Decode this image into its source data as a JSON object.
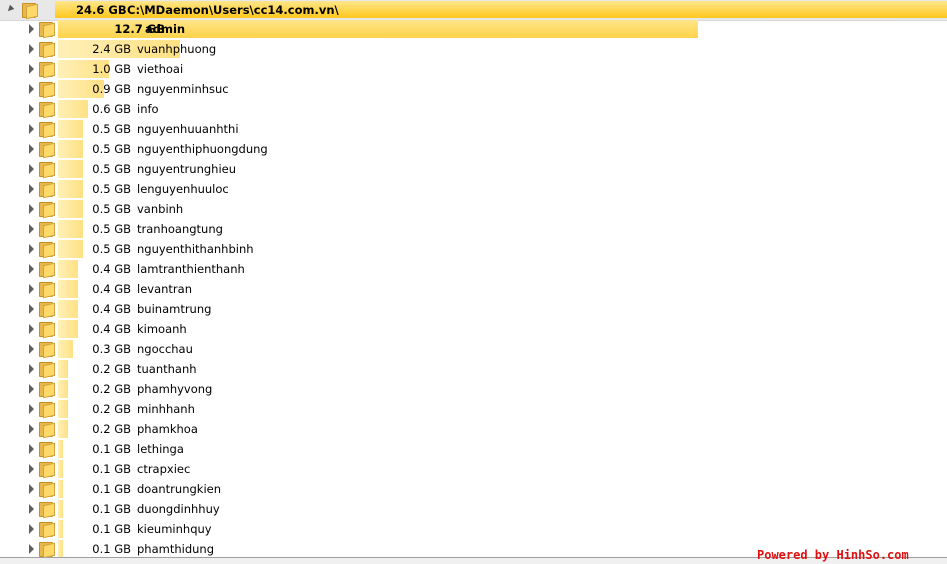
{
  "root": {
    "size": "24.6 GB",
    "path": "C:\\MDaemon\\Users\\cc14.com.vn\\",
    "fraction": 1.0
  },
  "folders": [
    {
      "size": "12.7 GB",
      "name": "admin",
      "fraction": 0.516
    },
    {
      "size": "2.4 GB",
      "name": "vuanhphuong",
      "fraction": 0.098
    },
    {
      "size": "1.0 GB",
      "name": "viethoai",
      "fraction": 0.041
    },
    {
      "size": "0.9 GB",
      "name": "nguyenminhsuc",
      "fraction": 0.037
    },
    {
      "size": "0.6 GB",
      "name": "info",
      "fraction": 0.024
    },
    {
      "size": "0.5 GB",
      "name": "nguyenhuuanhthi",
      "fraction": 0.02
    },
    {
      "size": "0.5 GB",
      "name": "nguyenthiphuongdung",
      "fraction": 0.02
    },
    {
      "size": "0.5 GB",
      "name": "nguyentrunghieu",
      "fraction": 0.02
    },
    {
      "size": "0.5 GB",
      "name": "lenguyenhuuloc",
      "fraction": 0.02
    },
    {
      "size": "0.5 GB",
      "name": "vanbinh",
      "fraction": 0.02
    },
    {
      "size": "0.5 GB",
      "name": "tranhoangtung",
      "fraction": 0.02
    },
    {
      "size": "0.5 GB",
      "name": "nguyenthithanhbinh",
      "fraction": 0.02
    },
    {
      "size": "0.4 GB",
      "name": "lamtranthienthanh",
      "fraction": 0.016
    },
    {
      "size": "0.4 GB",
      "name": "levantran",
      "fraction": 0.016
    },
    {
      "size": "0.4 GB",
      "name": "buinamtrung",
      "fraction": 0.016
    },
    {
      "size": "0.4 GB",
      "name": "kimoanh",
      "fraction": 0.016
    },
    {
      "size": "0.3 GB",
      "name": "ngocchau",
      "fraction": 0.012
    },
    {
      "size": "0.2 GB",
      "name": "tuanthanh",
      "fraction": 0.008
    },
    {
      "size": "0.2 GB",
      "name": "phamhyvong",
      "fraction": 0.008
    },
    {
      "size": "0.2 GB",
      "name": "minhhanh",
      "fraction": 0.008
    },
    {
      "size": "0.2 GB",
      "name": "phamkhoa",
      "fraction": 0.008
    },
    {
      "size": "0.1 GB",
      "name": "lethinga",
      "fraction": 0.004
    },
    {
      "size": "0.1 GB",
      "name": "ctrapxiec",
      "fraction": 0.004
    },
    {
      "size": "0.1 GB",
      "name": "doantrungkien",
      "fraction": 0.004
    },
    {
      "size": "0.1 GB",
      "name": "duongdinhhuy",
      "fraction": 0.004
    },
    {
      "size": "0.1 GB",
      "name": "kieuminhquy",
      "fraction": 0.004
    },
    {
      "size": "0.1 GB",
      "name": "phamthidung",
      "fraction": 0.004
    }
  ],
  "watermark": "Powered by HinhSo.com",
  "colors": {
    "bar_light": "#fff0b8",
    "bar_dark": "#ffc81e",
    "watermark": "#e01010"
  }
}
